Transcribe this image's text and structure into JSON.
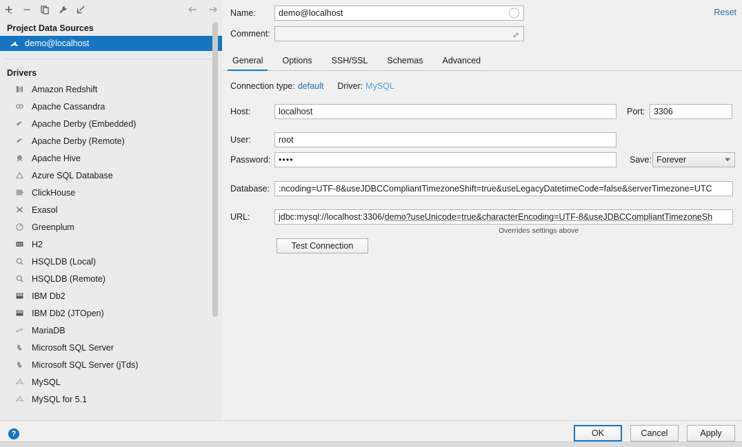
{
  "toolbar": {
    "buttons": [
      {
        "name": "add-button",
        "icon": "plus-icon"
      },
      {
        "name": "remove-button",
        "icon": "minus-icon"
      },
      {
        "name": "duplicate-button",
        "icon": "copy-icon"
      },
      {
        "name": "properties-button",
        "icon": "wrench-icon"
      },
      {
        "name": "jump-to-button",
        "icon": "arrow-into-corner-icon"
      }
    ],
    "nav_back": "back-arrow-icon",
    "nav_forward": "forward-arrow-icon"
  },
  "sidebar": {
    "project_group_title": "Project Data Sources",
    "data_sources": [
      {
        "label": "demo@localhost",
        "selected": true,
        "icon": "mysql-icon"
      }
    ],
    "drivers_title": "Drivers",
    "drivers": [
      {
        "label": "Amazon Redshift",
        "icon": "redshift-icon"
      },
      {
        "label": "Apache Cassandra",
        "icon": "cassandra-icon"
      },
      {
        "label": "Apache Derby (Embedded)",
        "icon": "derby-icon"
      },
      {
        "label": "Apache Derby (Remote)",
        "icon": "derby-icon"
      },
      {
        "label": "Apache Hive",
        "icon": "hive-icon"
      },
      {
        "label": "Azure SQL Database",
        "icon": "azure-icon"
      },
      {
        "label": "ClickHouse",
        "icon": "clickhouse-icon"
      },
      {
        "label": "Exasol",
        "icon": "exasol-icon"
      },
      {
        "label": "Greenplum",
        "icon": "greenplum-icon"
      },
      {
        "label": "H2",
        "icon": "h2-icon"
      },
      {
        "label": "HSQLDB (Local)",
        "icon": "hsqldb-icon"
      },
      {
        "label": "HSQLDB (Remote)",
        "icon": "hsqldb-icon"
      },
      {
        "label": "IBM Db2",
        "icon": "db2-icon"
      },
      {
        "label": "IBM Db2 (JTOpen)",
        "icon": "db2-icon"
      },
      {
        "label": "MariaDB",
        "icon": "mariadb-icon"
      },
      {
        "label": "Microsoft SQL Server",
        "icon": "mssql-icon"
      },
      {
        "label": "Microsoft SQL Server (jTds)",
        "icon": "mssql-icon"
      },
      {
        "label": "MySQL",
        "icon": "mysql-icon"
      },
      {
        "label": "MySQL for 5.1",
        "icon": "mysql-icon"
      }
    ]
  },
  "form": {
    "name_label": "Name:",
    "name_value": "demo@localhost",
    "comment_label": "Comment:",
    "comment_value": "",
    "reset_label": "Reset",
    "tabs": [
      {
        "label": "General",
        "active": true
      },
      {
        "label": "Options",
        "active": false
      },
      {
        "label": "SSH/SSL",
        "active": false
      },
      {
        "label": "Schemas",
        "active": false
      },
      {
        "label": "Advanced",
        "active": false
      }
    ],
    "connection_type_label": "Connection type:",
    "connection_type_value": "default",
    "driver_label": "Driver:",
    "driver_value": "MySQL",
    "host_label": "Host:",
    "host_value": "localhost",
    "port_label": "Port:",
    "port_value": "3306",
    "user_label": "User:",
    "user_value": "root",
    "password_label": "Password:",
    "password_value": "••••",
    "save_label": "Save:",
    "save_value": "Forever",
    "database_label": "Database:",
    "database_value": ":ncoding=UTF-8&useJDBCCompliantTimezoneShift=true&useLegacyDatetimeCode=false&serverTimezone=UTC",
    "url_label": "URL:",
    "url_prefix": "jdbc:mysql://localhost:3306/",
    "url_underlined": "demo?useUnicode=true&characterEncoding=UTF-8&useJDBCCompliantTimezoneSh",
    "url_hint": "Overrides settings above",
    "test_connection_label": "Test Connection"
  },
  "footer": {
    "help_glyph": "?",
    "ok_label": "OK",
    "cancel_label": "Cancel",
    "apply_label": "Apply"
  },
  "colors": {
    "accent": "#1675c0",
    "link": "#2d6ca8",
    "selection": "#1675c0"
  }
}
